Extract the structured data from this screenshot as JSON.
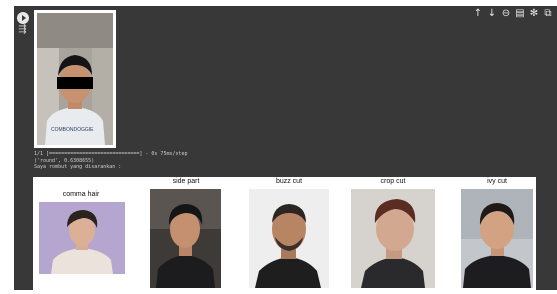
{
  "cell": {
    "run_icon": "play-icon",
    "output_icon": "output-toggle-icon"
  },
  "toolbar": {
    "icons": [
      "arrow-up-icon",
      "arrow-down-icon",
      "link-icon",
      "comment-icon",
      "gear-icon",
      "copy-icon"
    ],
    "glyphs": [
      "↑",
      "↓",
      "⊖",
      "▤",
      "✻",
      "⧉"
    ]
  },
  "input_image": {
    "subject": "input-photo",
    "censored": true
  },
  "console": {
    "line1": "1/1 [==============================] - 0s 75ms/step",
    "line2": "('round', 0.6308655)",
    "line3": "Saya rombut yang disarankan :"
  },
  "recommendations": [
    {
      "title": "comma hair"
    },
    {
      "title": "side part"
    },
    {
      "title": "buzz cut"
    },
    {
      "title": "crop cut"
    },
    {
      "title": "ivy cut"
    }
  ],
  "colors": {
    "background": "#383838",
    "console_text": "#cfcfcf",
    "panel": "#ffffff"
  }
}
